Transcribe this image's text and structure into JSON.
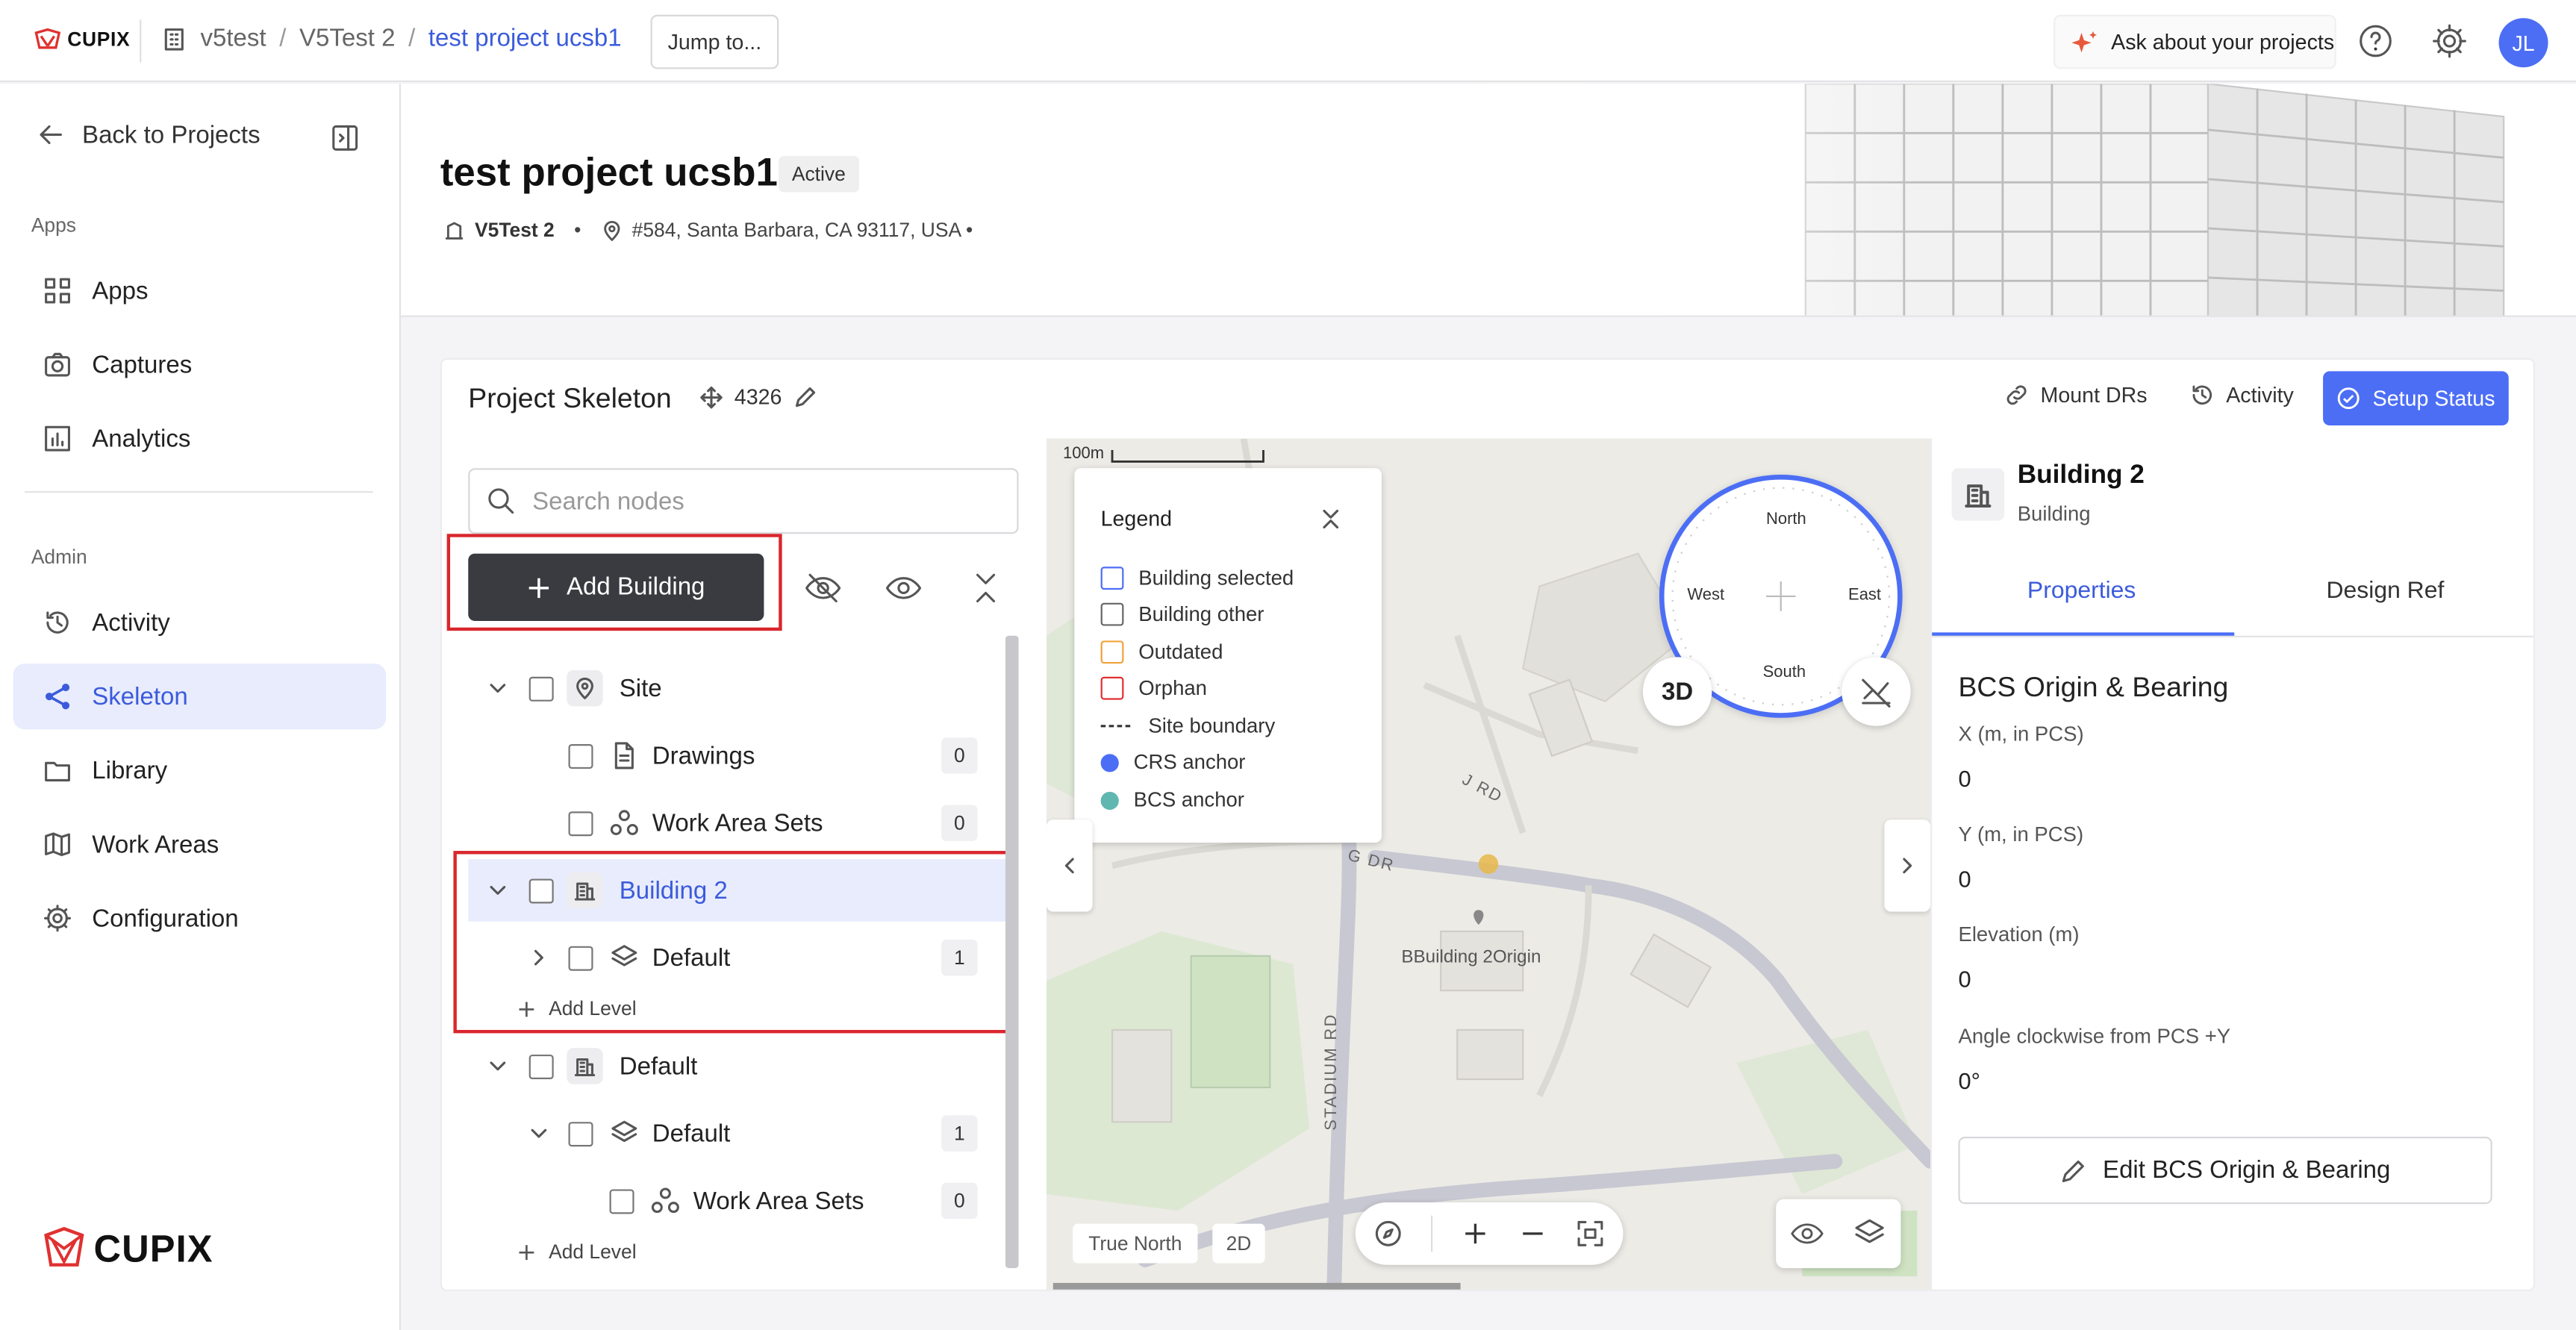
{
  "topbar": {
    "logo_text": "CUPIX",
    "breadcrumb": [
      "v5test",
      "V5Test 2",
      "test project ucsb1"
    ],
    "jump_label": "Jump to...",
    "ask_label": "Ask about your projects",
    "avatar_initials": "JL"
  },
  "sidebar": {
    "back_label": "Back to Projects",
    "apps_heading": "Apps",
    "apps_items": [
      {
        "label": "Apps",
        "icon": "apps-grid-icon"
      },
      {
        "label": "Captures",
        "icon": "camera-icon"
      },
      {
        "label": "Analytics",
        "icon": "analytics-icon"
      }
    ],
    "admin_heading": "Admin",
    "admin_items": [
      {
        "label": "Activity",
        "icon": "history-icon"
      },
      {
        "label": "Skeleton",
        "icon": "skeleton-icon",
        "active": true
      },
      {
        "label": "Library",
        "icon": "folder-icon"
      },
      {
        "label": "Work Areas",
        "icon": "map-icon"
      },
      {
        "label": "Configuration",
        "icon": "gear-icon"
      }
    ],
    "logo_text": "CUPIX"
  },
  "project": {
    "title": "test project ucsb1",
    "status": "Active",
    "workspace": "V5Test 2",
    "address": "#584, Santa Barbara, CA 93117, USA •"
  },
  "skeleton": {
    "title": "Project Skeleton",
    "epsg": "4326",
    "mount_label": "Mount DRs",
    "activity_label": "Activity",
    "setup_label": "Setup Status",
    "search_placeholder": "Search nodes",
    "add_building_label": "Add Building",
    "tree": {
      "site": "Site",
      "drawings": "Drawings",
      "drawings_count": "0",
      "work_area_sets": "Work Area Sets",
      "work_area_sets_count": "0",
      "building2": "Building 2",
      "b2_level": "Default",
      "b2_level_count": "1",
      "add_level": "Add Level",
      "building_default": "Default",
      "bd_level": "Default",
      "bd_level_count": "1",
      "bd_was": "Work Area Sets",
      "bd_was_count": "0",
      "add_level2": "Add Level"
    }
  },
  "map": {
    "scale_label": "100m",
    "legend": {
      "title": "Legend",
      "items": [
        {
          "label": "Building selected",
          "color": "#4c6ef5"
        },
        {
          "label": "Building other",
          "color": "#666666"
        },
        {
          "label": "Outdated",
          "color": "#f0a33c"
        },
        {
          "label": "Orphan",
          "color": "#e03131"
        },
        {
          "label": "Site boundary",
          "color": "#333333"
        },
        {
          "label": "CRS anchor",
          "color": "#4c6ef5"
        },
        {
          "label": "BCS anchor",
          "color": "#5fb7b0"
        }
      ]
    },
    "compass": {
      "north": "North",
      "south": "South",
      "east": "East",
      "west": "West"
    },
    "btn_3d": "3D",
    "street_1": "J RD",
    "street_2": "G DR",
    "street_3": "STADIUM RD",
    "origin_label": "BBuilding 2Origin",
    "true_north": "True North",
    "btn_2d": "2D"
  },
  "properties": {
    "title": "Building 2",
    "subtitle": "Building",
    "tab_properties": "Properties",
    "tab_design": "Design Ref",
    "section": "BCS Origin & Bearing",
    "fields": [
      {
        "label": "X (m, in PCS)",
        "value": "0"
      },
      {
        "label": "Y (m, in PCS)",
        "value": "0"
      },
      {
        "label": "Elevation (m)",
        "value": "0"
      },
      {
        "label": "Angle clockwise from PCS +Y",
        "value": "0°"
      }
    ],
    "edit_label": "Edit BCS Origin & Bearing"
  },
  "colors": {
    "accent": "#4c6ef5",
    "highlight": "#d9262d"
  }
}
